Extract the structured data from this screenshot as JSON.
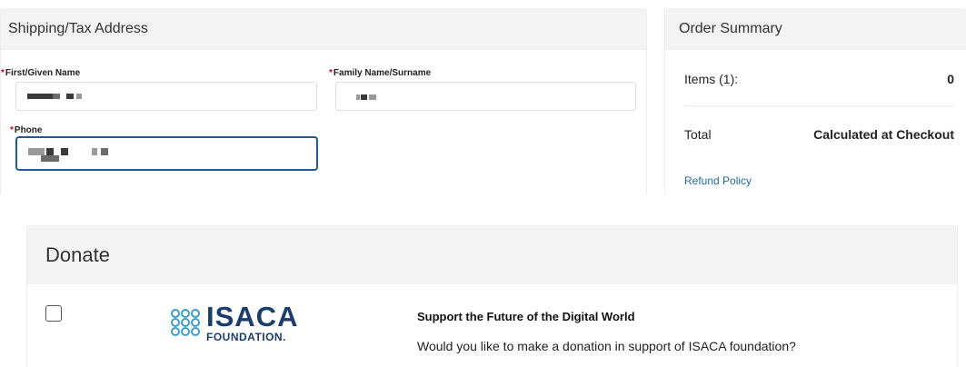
{
  "shipping": {
    "title": "Shipping/Tax Address",
    "required_marker": "*",
    "first_name_label": "First/Given Name",
    "family_name_label": "Family Name/Surname",
    "phone_label": "Phone"
  },
  "summary": {
    "title": "Order Summary",
    "items_label": "Items (1):",
    "items_value": "0",
    "total_label": "Total",
    "total_value": "Calculated at Checkout",
    "refund_link": "Refund Policy"
  },
  "donate": {
    "title": "Donate",
    "logo_main": "ISACA",
    "logo_sub": "FOUNDATION.",
    "headline": "Support the Future of the Digital World",
    "question": "Would you like to make a donation in support of ISACA foundation?",
    "checked": false
  },
  "colors": {
    "required": "#d0021b",
    "link": "#1e6aa6",
    "focus_border": "#1e5a96",
    "logo": "#1b3d6e",
    "logo_rings": "#3aa0c8"
  }
}
